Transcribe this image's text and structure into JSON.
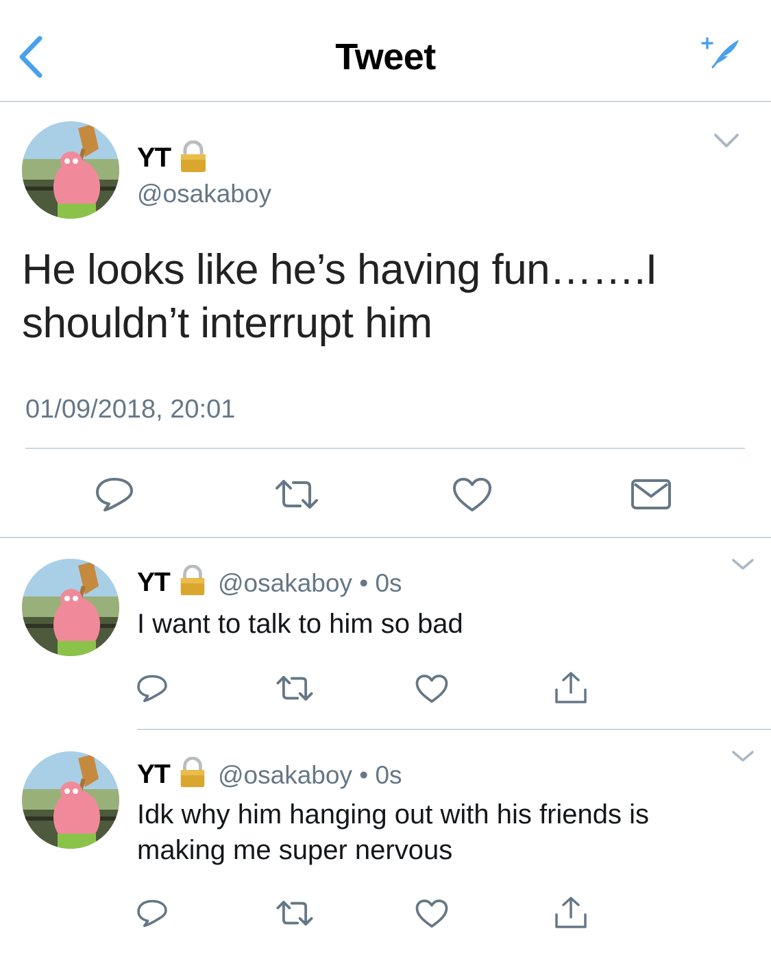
{
  "header": {
    "title": "Tweet",
    "back_icon": "chevron-left-icon",
    "compose_icon": "compose-sparkle-icon",
    "accent_color": "#4aa1eb"
  },
  "main_tweet": {
    "display_name": "YT",
    "handle": "@osakaboy",
    "protected_icon": "lock-icon",
    "text_line1": "He looks like he’s having fun…….I",
    "text_line2": "shouldn’t interrupt him",
    "timestamp": "01/09/2018, 20:01",
    "actions": [
      "reply-icon",
      "retweet-icon",
      "like-icon",
      "message-icon"
    ]
  },
  "replies": [
    {
      "display_name": "YT",
      "handle_time": "@osakaboy • 0s",
      "text": "I want to talk to him so bad",
      "actions": [
        "reply-icon",
        "retweet-icon",
        "like-icon",
        "share-icon"
      ]
    },
    {
      "display_name": "YT",
      "handle_time": "@osakaboy • 0s",
      "text": "Idk why him hanging out with his friends is making me super nervous",
      "actions": [
        "reply-icon",
        "retweet-icon",
        "like-icon",
        "share-icon"
      ]
    }
  ],
  "colors": {
    "text_primary": "#14171a",
    "text_secondary": "#657786",
    "icon_gray": "#657786",
    "divider": "#ccd6dd"
  }
}
